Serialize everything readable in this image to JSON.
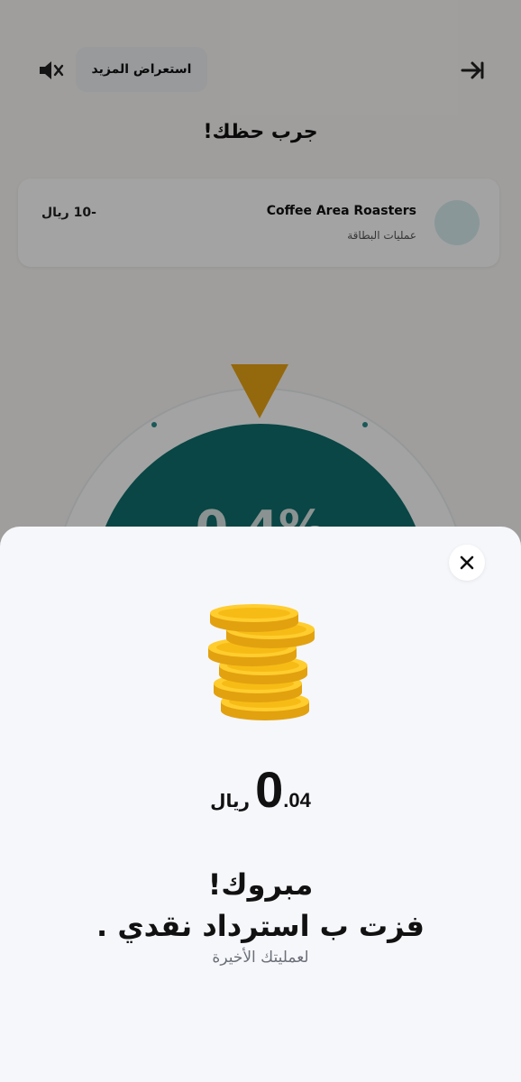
{
  "background": {
    "header": {
      "more_chip_label": "استعراض المزيد",
      "page_title": "جرب حظك!"
    },
    "merchant": {
      "name": "Coffee Area Roasters",
      "subtitle": "عمليات البطاقة",
      "amount": "-10 ريال"
    },
    "wheel": {
      "percent_label": "0.4%"
    },
    "colors": {
      "pointer": "#e8a315",
      "wheel": "#0f6e6c"
    }
  },
  "sheet": {
    "close_icon": "close-icon",
    "illustration": "coin-stack-icon",
    "reward": {
      "integer": "0",
      "decimal": ".04",
      "currency": "ريال"
    },
    "congrats_title": "مبروك!",
    "won_text": "فزت ب استرداد نقدي .",
    "subtitle": "لعمليتك الأخيرة"
  }
}
